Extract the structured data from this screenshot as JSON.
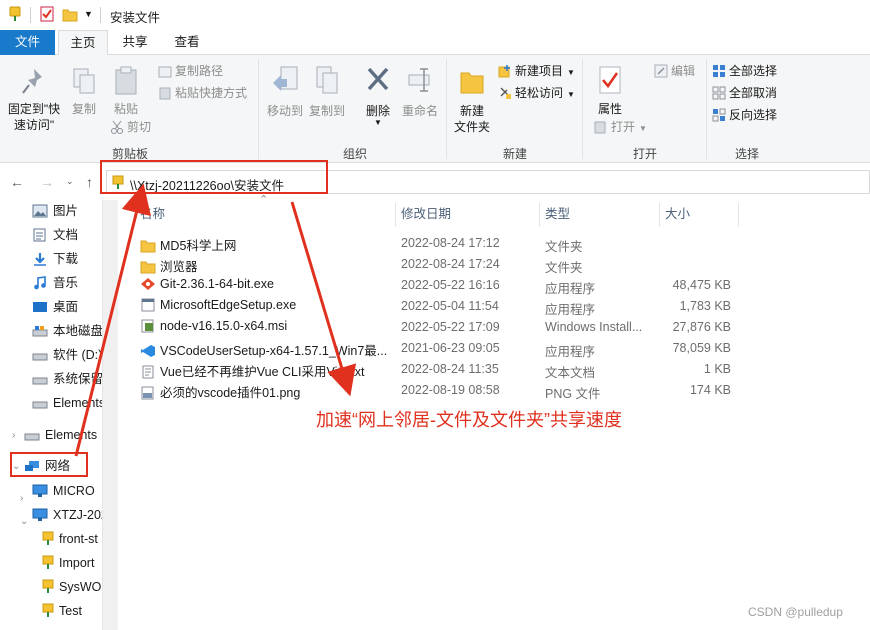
{
  "window": {
    "title": "安装文件"
  },
  "ribbon_tabs": [
    {
      "label": "文件"
    },
    {
      "label": "主页"
    },
    {
      "label": "共享"
    },
    {
      "label": "查看"
    }
  ],
  "ribbon": {
    "clipboard": {
      "label": "剪贴板",
      "pin_label": "固定到\"快\n速访问\"",
      "copy_label": "复制",
      "paste_label": "粘贴",
      "copy_path_label": "复制路径",
      "paste_shortcut_label": "粘贴快捷方式",
      "cut_label": "剪切"
    },
    "organize": {
      "label": "组织",
      "move_to_label": "移动到",
      "copy_to_label": "复制到",
      "delete_label": "删除",
      "rename_label": "重命名"
    },
    "new": {
      "label": "新建",
      "new_folder_label": "新建\n文件夹",
      "new_item_label": "新建项目",
      "easy_access_label": "轻松访问"
    },
    "open": {
      "label": "打开",
      "properties_label": "属性",
      "open_label": "打开",
      "edit_label": "编辑"
    },
    "select": {
      "label": "选择",
      "select_all_label": "全部选择",
      "select_none_label": "全部取消",
      "invert_label": "反向选择"
    }
  },
  "address": {
    "path": "\\\\Xtzj-20211226oo\\安装文件"
  },
  "nav_pane": {
    "items": [
      {
        "label": "图片",
        "icon": "pictures-icon"
      },
      {
        "label": "文档",
        "icon": "documents-icon"
      },
      {
        "label": "下载",
        "icon": "downloads-icon"
      },
      {
        "label": "音乐",
        "icon": "music-icon"
      },
      {
        "label": "桌面",
        "icon": "desktop-icon"
      },
      {
        "label": "本地磁盘",
        "icon": "drive-icon"
      },
      {
        "label": "软件 (D:)",
        "icon": "drive-icon"
      },
      {
        "label": "系统保留",
        "icon": "drive-icon"
      },
      {
        "label": "Elements",
        "icon": "drive-icon"
      },
      {
        "label": "Elements",
        "icon": "drive-icon"
      },
      {
        "label": "网络",
        "icon": "network-icon"
      },
      {
        "label": "MICRO",
        "icon": "computer-icon"
      },
      {
        "label": "XTZJ-202",
        "icon": "computer-icon"
      },
      {
        "label": "front-st",
        "icon": "share-folder-icon"
      },
      {
        "label": "Import",
        "icon": "share-folder-icon"
      },
      {
        "label": "SysWO",
        "icon": "share-folder-icon"
      },
      {
        "label": "Test",
        "icon": "share-folder-icon"
      }
    ]
  },
  "columns": {
    "name": "名称",
    "date": "修改日期",
    "type": "类型",
    "size": "大小"
  },
  "files": [
    {
      "name": "MD5科学上网",
      "date": "2022-08-24 17:12",
      "type": "文件夹",
      "size": "",
      "icon": "folder-icon"
    },
    {
      "name": "浏览器",
      "date": "2022-08-24 17:24",
      "type": "文件夹",
      "size": "",
      "icon": "folder-icon"
    },
    {
      "name": "Git-2.36.1-64-bit.exe",
      "date": "2022-05-22 16:16",
      "type": "应用程序",
      "size": "48,475 KB",
      "icon": "git-icon"
    },
    {
      "name": "MicrosoftEdgeSetup.exe",
      "date": "2022-05-04 11:54",
      "type": "应用程序",
      "size": "1,783 KB",
      "icon": "exe-icon"
    },
    {
      "name": "node-v16.15.0-x64.msi",
      "date": "2022-05-22 17:09",
      "type": "Windows Install...",
      "size": "27,876 KB",
      "icon": "msi-icon"
    },
    {
      "name": "VSCodeUserSetup-x64-1.57.1_Win7最...",
      "date": "2021-06-23 09:05",
      "type": "应用程序",
      "size": "78,059 KB",
      "icon": "vscode-icon"
    },
    {
      "name": "Vue已经不再维护Vue CLI采用Vite.txt",
      "date": "2022-08-24 11:35",
      "type": "文本文档",
      "size": "1 KB",
      "icon": "txt-icon"
    },
    {
      "name": "必须的vscode插件01.png",
      "date": "2022-08-19 08:58",
      "type": "PNG 文件",
      "size": "174 KB",
      "icon": "png-icon"
    }
  ],
  "annotation": {
    "text": "加速“网上邻居-文件及文件夹”共享速度",
    "color": "#e0301e"
  },
  "watermark": "CSDN @pulledup",
  "colors": {
    "accent": "#1979ca",
    "folder": "#f5c542",
    "annotation_red": "#e0301e"
  }
}
